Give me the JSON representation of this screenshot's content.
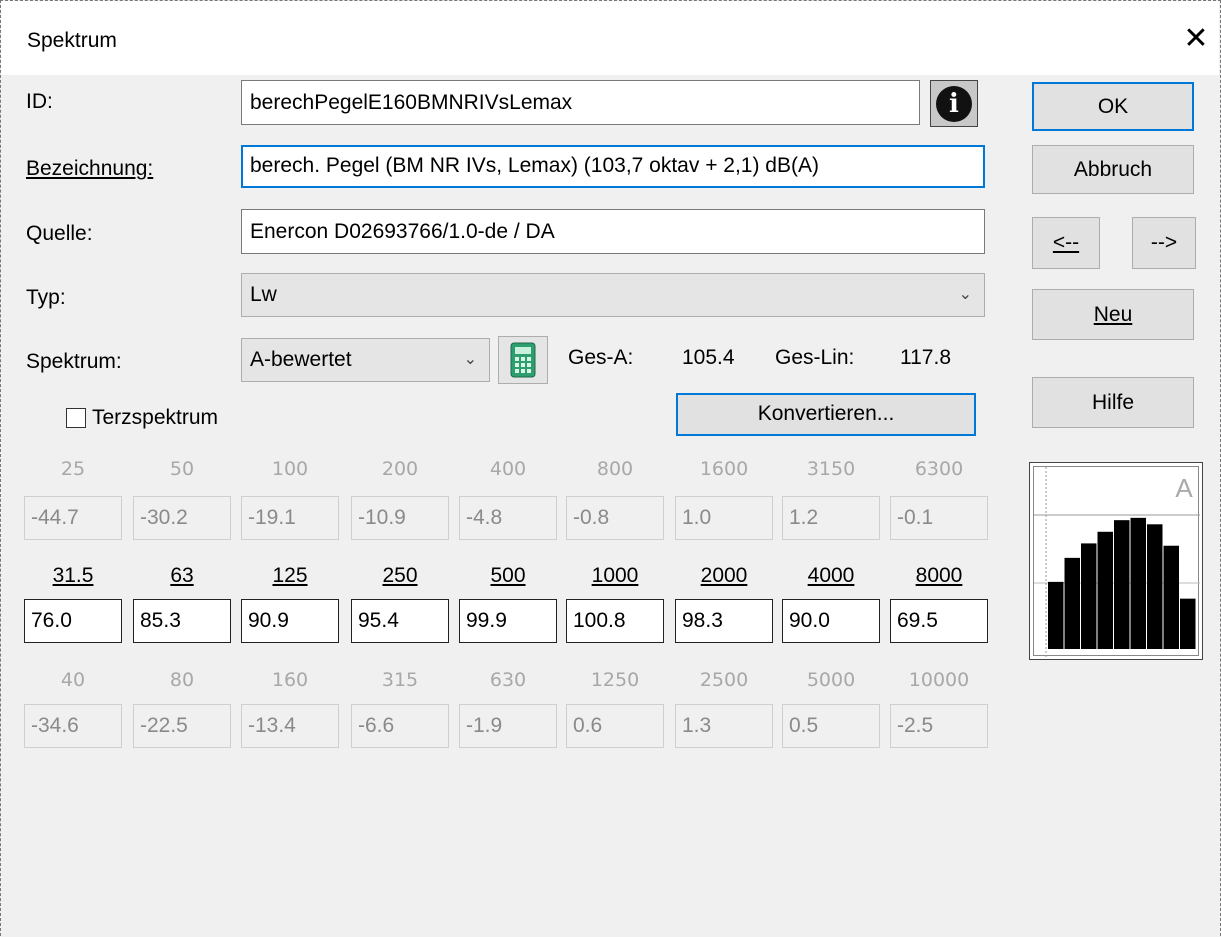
{
  "dialog": {
    "title": "Spektrum"
  },
  "form": {
    "id_label": "ID:",
    "id_value": "berechPegelE160BMNRIVsLemax",
    "bezeichnung_label": "Bezeichnung:",
    "bezeichnung_value": "berech. Pegel (BM NR IVs, Lemax) (103,7 oktav + 2,1)  dB(A)",
    "quelle_label": "Quelle:",
    "quelle_value": "Enercon D02693766/1.0-de / DA",
    "typ_label": "Typ:",
    "typ_value": "Lw",
    "spektrum_label": "Spektrum:",
    "spektrum_value": "A-bewertet",
    "ges_a_label": "Ges-A:",
    "ges_a_value": "105.4",
    "ges_lin_label": "Ges-Lin:",
    "ges_lin_value": "117.8",
    "terz_label": "Terzspektrum",
    "terz_checked": false,
    "konvertieren_label": "Konvertieren..."
  },
  "buttons": {
    "ok": "OK",
    "abbruch": "Abbruch",
    "prev": "<--",
    "next": "-->",
    "neu": "Neu",
    "hilfe": "Hilfe"
  },
  "spectrum": {
    "row_upper": {
      "freqs": [
        "25",
        "50",
        "100",
        "200",
        "400",
        "800",
        "1600",
        "3150",
        "6300"
      ],
      "values": [
        "-44.7",
        "-30.2",
        "-19.1",
        "-10.9",
        "-4.8",
        "-0.8",
        "1.0",
        "1.2",
        "-0.1"
      ]
    },
    "row_octave": {
      "freqs": [
        "31.5",
        "63",
        "125",
        "250",
        "500",
        "1000",
        "2000",
        "4000",
        "8000"
      ],
      "values": [
        "76.0",
        "85.3",
        "90.9",
        "95.4",
        "99.9",
        "100.8",
        "98.3",
        "90.0",
        "69.5"
      ]
    },
    "row_lower": {
      "freqs": [
        "40",
        "80",
        "160",
        "315",
        "630",
        "1250",
        "2500",
        "5000",
        "10000"
      ],
      "values": [
        "-34.6",
        "-22.5",
        "-13.4",
        "-6.6",
        "-1.9",
        "0.6",
        "1.3",
        "0.5",
        "-2.5"
      ]
    }
  },
  "preview": {
    "letter": "A"
  },
  "colors": {
    "accent": "#0078d7",
    "dialog_bg": "#f0f0f0"
  }
}
